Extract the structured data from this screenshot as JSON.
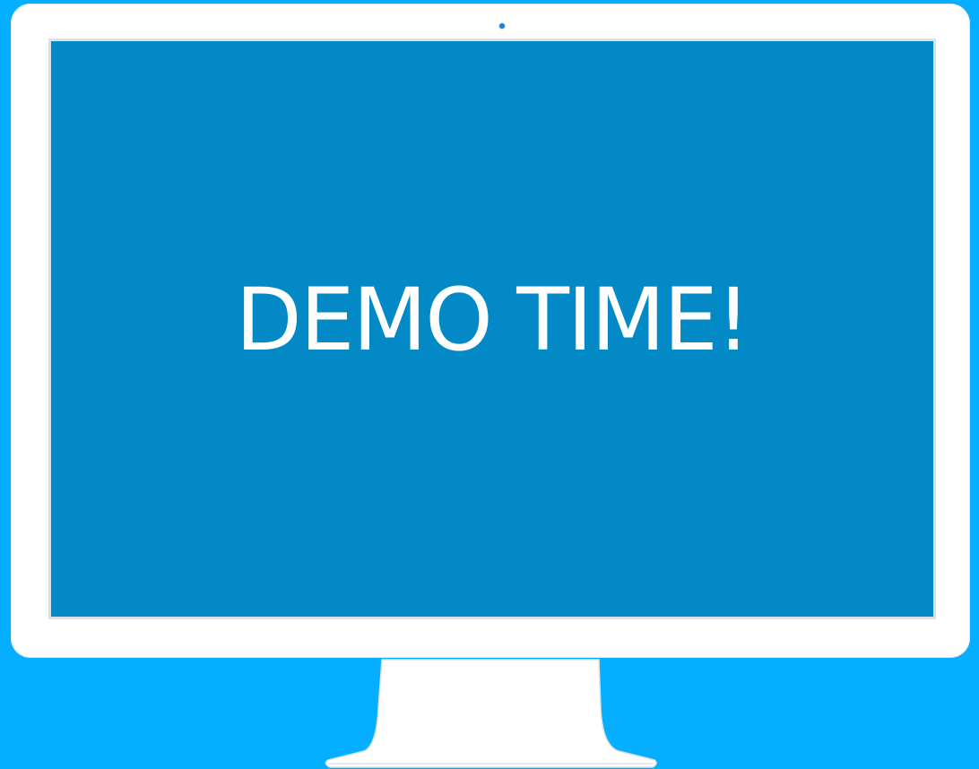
{
  "screen": {
    "text": "DEMO TIME!"
  },
  "colors": {
    "background": "#05aeff",
    "bezel": "#ffffff",
    "screen": "#0389c6",
    "text": "#ffffff",
    "camera": "#1f7fd1"
  }
}
